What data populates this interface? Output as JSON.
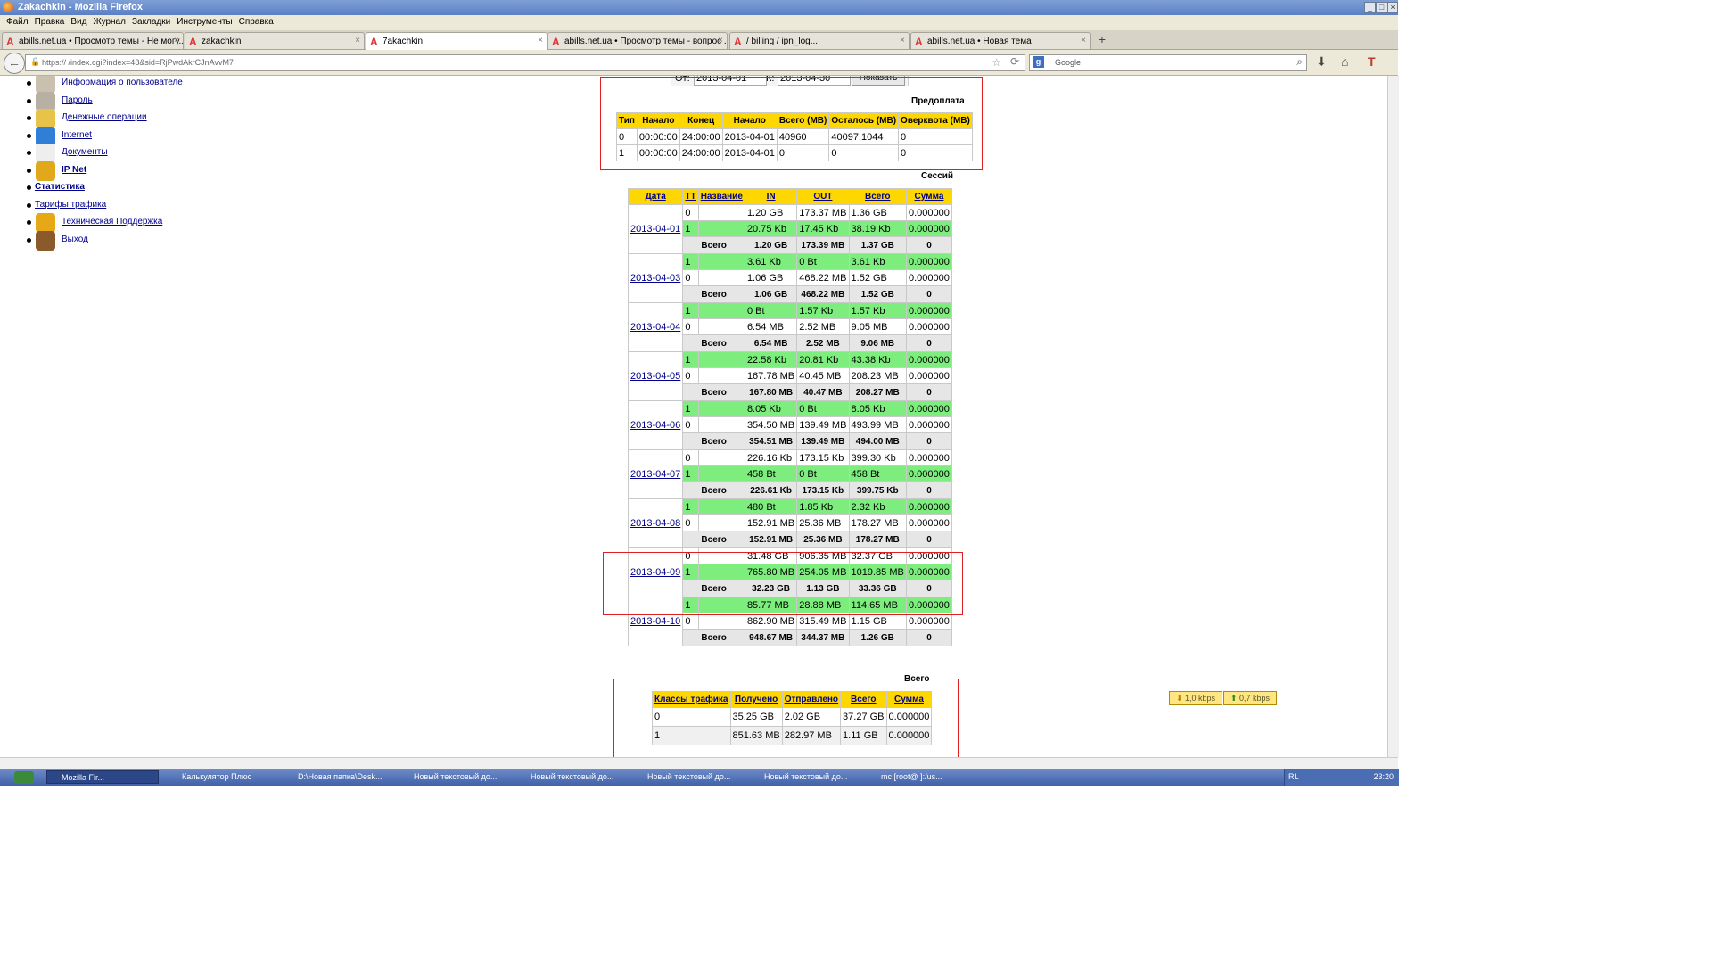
{
  "window": {
    "title": "Zakachkin - Mozilla Firefox"
  },
  "menu": [
    "Файл",
    "Правка",
    "Вид",
    "Журнал",
    "Закладки",
    "Инструменты",
    "Справка"
  ],
  "tabs": [
    {
      "label": "abills.net.ua • Просмотр темы - Не могу..."
    },
    {
      "label": "zakachkin"
    },
    {
      "label": "7akachkin"
    },
    {
      "label": "abills.net.ua • Просмотр темы - вопрос ..."
    },
    {
      "label": "/ billing / ipn_log..."
    },
    {
      "label": "abills.net.ua • Новая тема"
    }
  ],
  "address": {
    "url": "https://                 /index.cgi?index=48&sid=RjPwdAkrCJnAvvM7"
  },
  "search": {
    "placeholder": "Google"
  },
  "sidebar": [
    {
      "label": "Информация о пользователе",
      "icon": "user-info-icon"
    },
    {
      "label": "Пароль",
      "icon": "password-icon"
    },
    {
      "label": "Денежные операции",
      "icon": "money-icon"
    },
    {
      "label": "Internet",
      "icon": "internet-icon"
    },
    {
      "label": "Документы",
      "icon": "document-icon"
    },
    {
      "label": "IP Net",
      "icon": "ipnet-icon"
    },
    {
      "label": "Статистика",
      "icon": ""
    },
    {
      "label": "Тарифы трафика",
      "icon": ""
    },
    {
      "label": "Техническая Поддержка",
      "icon": "support-icon"
    },
    {
      "label": "Выход",
      "icon": "exit-icon"
    }
  ],
  "filter": {
    "from_label": "От:",
    "from": "2013-04-01",
    "to_label": "К:",
    "to": "2013-04-30",
    "show_button": "Показать"
  },
  "prepaid": {
    "caption": "Предоплата",
    "headers": [
      "Тип",
      "Начало",
      "Конец",
      "Начало",
      "Всего (MB)",
      "Осталось (MB)",
      "Оверквота (MB)"
    ],
    "rows": [
      [
        "0",
        "00:00:00",
        "24:00:00",
        "2013-04-01",
        "40960",
        "40097.1044",
        "0"
      ],
      [
        "1",
        "00:00:00",
        "24:00:00",
        "2013-04-01",
        "0",
        "0",
        "0"
      ]
    ]
  },
  "sessions": {
    "caption": "Сессий",
    "headers": [
      "Дата",
      "TT",
      "Название",
      "IN",
      "OUT",
      "Всего",
      "Сумма"
    ],
    "total_label": "Всего",
    "days": [
      {
        "date": "2013-04-01",
        "rows": [
          {
            "tt": "0",
            "in": "1.20 GB",
            "out": "173.37 MB",
            "total": "1.36 GB",
            "sum": "0.000000",
            "green": false
          },
          {
            "tt": "1",
            "in": "20.75 Kb",
            "out": "17.45 Kb",
            "total": "38.19 Kb",
            "sum": "0.000000",
            "green": true
          }
        ],
        "totals": {
          "in": "1.20 GB",
          "out": "173.39 MB",
          "total": "1.37 GB",
          "sum": "0"
        }
      },
      {
        "date": "2013-04-03",
        "rows": [
          {
            "tt": "1",
            "in": "3.61 Kb",
            "out": "0 Bt",
            "total": "3.61 Kb",
            "sum": "0.000000",
            "green": true
          },
          {
            "tt": "0",
            "in": "1.06 GB",
            "out": "468.22 MB",
            "total": "1.52 GB",
            "sum": "0.000000",
            "green": false
          }
        ],
        "totals": {
          "in": "1.06 GB",
          "out": "468.22 MB",
          "total": "1.52 GB",
          "sum": "0"
        }
      },
      {
        "date": "2013-04-04",
        "rows": [
          {
            "tt": "1",
            "in": "0 Bt",
            "out": "1.57 Kb",
            "total": "1.57 Kb",
            "sum": "0.000000",
            "green": true
          },
          {
            "tt": "0",
            "in": "6.54 MB",
            "out": "2.52 MB",
            "total": "9.05 MB",
            "sum": "0.000000",
            "green": false
          }
        ],
        "totals": {
          "in": "6.54 MB",
          "out": "2.52 MB",
          "total": "9.06 MB",
          "sum": "0"
        }
      },
      {
        "date": "2013-04-05",
        "rows": [
          {
            "tt": "1",
            "in": "22.58 Kb",
            "out": "20.81 Kb",
            "total": "43.38 Kb",
            "sum": "0.000000",
            "green": true
          },
          {
            "tt": "0",
            "in": "167.78 MB",
            "out": "40.45 MB",
            "total": "208.23 MB",
            "sum": "0.000000",
            "green": false
          }
        ],
        "totals": {
          "in": "167.80 MB",
          "out": "40.47 MB",
          "total": "208.27 MB",
          "sum": "0"
        }
      },
      {
        "date": "2013-04-06",
        "rows": [
          {
            "tt": "1",
            "in": "8.05 Kb",
            "out": "0 Bt",
            "total": "8.05 Kb",
            "sum": "0.000000",
            "green": true
          },
          {
            "tt": "0",
            "in": "354.50 MB",
            "out": "139.49 MB",
            "total": "493.99 MB",
            "sum": "0.000000",
            "green": false
          }
        ],
        "totals": {
          "in": "354.51 MB",
          "out": "139.49 MB",
          "total": "494.00 MB",
          "sum": "0"
        }
      },
      {
        "date": "2013-04-07",
        "rows": [
          {
            "tt": "0",
            "in": "226.16 Kb",
            "out": "173.15 Kb",
            "total": "399.30 Kb",
            "sum": "0.000000",
            "green": false
          },
          {
            "tt": "1",
            "in": "458 Bt",
            "out": "0 Bt",
            "total": "458 Bt",
            "sum": "0.000000",
            "green": true
          }
        ],
        "totals": {
          "in": "226.61 Kb",
          "out": "173.15 Kb",
          "total": "399.75 Kb",
          "sum": "0"
        }
      },
      {
        "date": "2013-04-08",
        "rows": [
          {
            "tt": "1",
            "in": "480 Bt",
            "out": "1.85 Kb",
            "total": "2.32 Kb",
            "sum": "0.000000",
            "green": true
          },
          {
            "tt": "0",
            "in": "152.91 MB",
            "out": "25.36 MB",
            "total": "178.27 MB",
            "sum": "0.000000",
            "green": false
          }
        ],
        "totals": {
          "in": "152.91 MB",
          "out": "25.36 MB",
          "total": "178.27 MB",
          "sum": "0"
        }
      },
      {
        "date": "2013-04-09",
        "rows": [
          {
            "tt": "0",
            "in": "31.48 GB",
            "out": "906.35 MB",
            "total": "32.37 GB",
            "sum": "0.000000",
            "green": false
          },
          {
            "tt": "1",
            "in": "765.80 MB",
            "out": "254.05 MB",
            "total": "1019.85 MB",
            "sum": "0.000000",
            "green": true
          }
        ],
        "totals": {
          "in": "32.23 GB",
          "out": "1.13 GB",
          "total": "33.36 GB",
          "sum": "0"
        }
      },
      {
        "date": "2013-04-10",
        "rows": [
          {
            "tt": "1",
            "in": "85.77 MB",
            "out": "28.88 MB",
            "total": "114.65 MB",
            "sum": "0.000000",
            "green": true
          },
          {
            "tt": "0",
            "in": "862.90 MB",
            "out": "315.49 MB",
            "total": "1.15 GB",
            "sum": "0.000000",
            "green": false
          }
        ],
        "totals": {
          "in": "948.67 MB",
          "out": "344.37 MB",
          "total": "1.26 GB",
          "sum": "0"
        }
      }
    ]
  },
  "summary": {
    "caption": "Всего",
    "headers": [
      "Классы трафика",
      "Получено",
      "Отправлено",
      "Всего",
      "Сумма"
    ],
    "rows": [
      [
        "0",
        "35.25 GB",
        "2.02 GB",
        "37.27 GB",
        "0.000000"
      ],
      [
        "1",
        "851.63 MB",
        "282.97 MB",
        "1.11 GB",
        "0.000000"
      ]
    ]
  },
  "kbps": {
    "down": "1,0 kbps",
    "up": "0,7 kbps"
  },
  "taskbar": {
    "items": [
      "Mozilla Fir...",
      "Калькулятор Плюс",
      "D:\\Новая папка\\Desk...",
      "Новый текстовый до...",
      "Новый текстовый до...",
      "Новый текстовый до...",
      "Новый текстовый до...",
      "mc [root@          ]:/us..."
    ],
    "lang": "RL",
    "clock": "23:20"
  },
  "colors": {
    "header": "#ffd700",
    "green_row": "#7dee7d",
    "total_row": "#e6e6e6",
    "highlight": "#e02020"
  }
}
